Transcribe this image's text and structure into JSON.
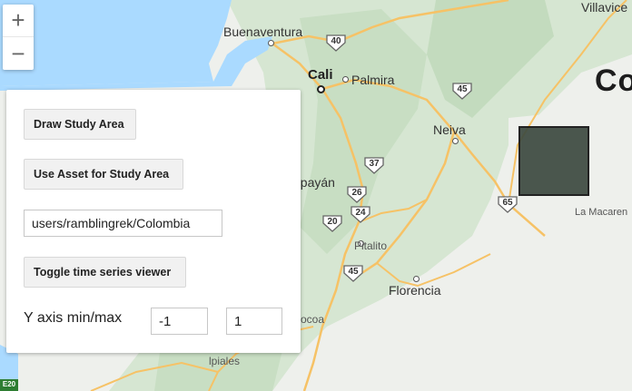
{
  "map": {
    "country_label": "Co",
    "cities": {
      "cali": "Cali",
      "palmira": "Palmira",
      "neiva": "Neiva",
      "buenaventura": "Buenaventura",
      "villavicencio": "Villavice",
      "popayan": "opayán",
      "pitalito": "Pitalito",
      "florencia": "Florencia",
      "mocoa": "ocoa",
      "ipiales": "lpiales",
      "la_macarena": "La Macaren"
    },
    "road_shields": [
      "40",
      "45",
      "37",
      "26",
      "24",
      "20",
      "45",
      "65",
      "E20"
    ]
  },
  "zoom": {
    "in_label": "+",
    "out_label": "−"
  },
  "panel": {
    "draw_study_area": "Draw Study Area",
    "use_asset": "Use Asset for Study Area",
    "asset_path": "users/ramblingrek/Colombia",
    "toggle_viewer": "Toggle time series viewer",
    "y_axis_label": "Y axis min/max",
    "y_min": "-1",
    "y_max": "1"
  },
  "colors": {
    "water": "#aadaff",
    "terrain": "#d4e5d0",
    "lowland": "#eef0ec",
    "road": "#f6c266",
    "study_area": "#3d4a40"
  }
}
